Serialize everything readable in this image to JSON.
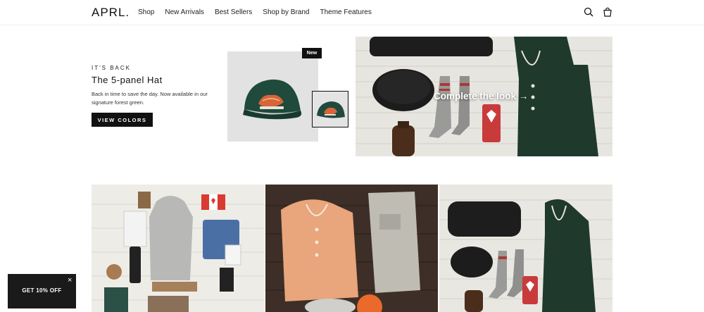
{
  "header": {
    "logo": "APRL.",
    "nav": [
      "Shop",
      "New Arrivals",
      "Best Sellers",
      "Shop by Brand",
      "Theme Features"
    ],
    "icons": [
      "search-icon",
      "cart-icon"
    ]
  },
  "hero": {
    "eyebrow": "IT'S BACK",
    "title": "The 5-panel Hat",
    "description": "Back in time to save the day. Now available in our signature forest green.",
    "button_label": "VIEW COLORS",
    "badge": "New",
    "cta": "Complete the look →"
  },
  "promo": {
    "label": "GET 10% OFF",
    "close": "×"
  },
  "colors": {
    "text": "#111111",
    "button_bg": "#111111",
    "product_bg": "#e2e2e2",
    "hat_green": "#1f4a3c",
    "forest_green": "#1f3a2c",
    "wood_light": "#e7e5e0",
    "wood_dark": "#3b2e26",
    "promo_bg": "#1a1a1a"
  }
}
